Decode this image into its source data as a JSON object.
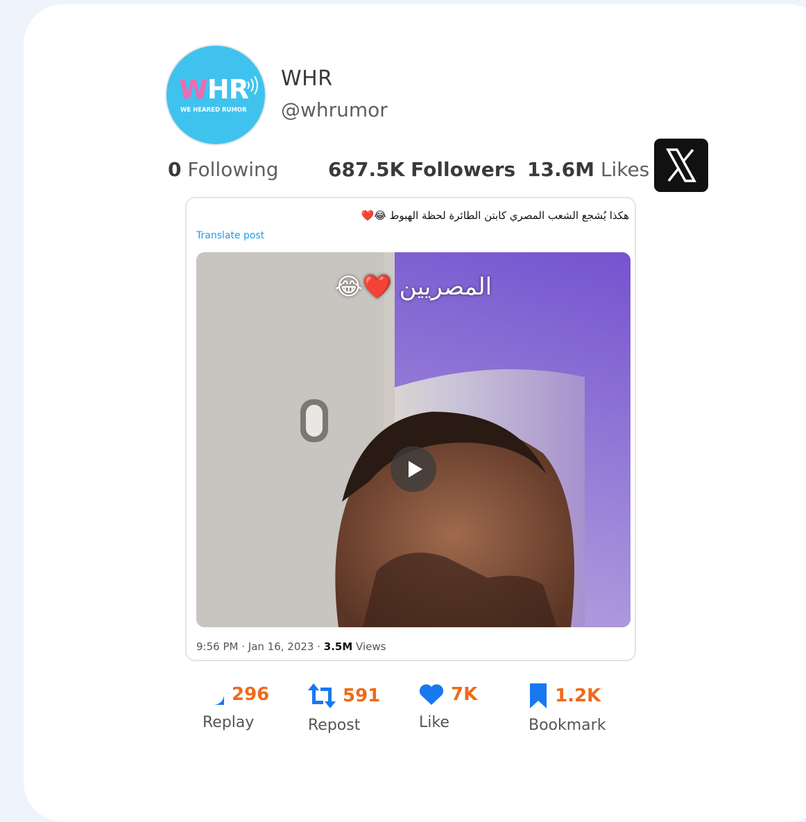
{
  "profile": {
    "name": "WHR",
    "handle": "@whrumor",
    "logo_w": "W",
    "logo_hr": "HR",
    "logo_tagline": "WE HEARED RUMOR"
  },
  "stats": {
    "following_count": "0",
    "following_label": "Following",
    "followers_count": "687.5K",
    "followers_label": "Followers",
    "likes_count": "13.6M",
    "likes_label": "Likes"
  },
  "tweet": {
    "text": "هكذا يُشجع الشعب المصري كابتن الطائرة لحظة الهبوط 😂❤️",
    "translate_label": "Translate post",
    "media_caption": "المصريين ❤️😂",
    "time": "9:56 PM",
    "date": "Jan 16, 2023",
    "views_count": "3.5M",
    "views_label": "Views"
  },
  "actions": [
    {
      "icon": "reply-icon",
      "count": "296",
      "label": "Replay"
    },
    {
      "icon": "repost-icon",
      "count": "591",
      "label": "Repost"
    },
    {
      "icon": "heart-icon",
      "count": "7K",
      "label": "Like"
    },
    {
      "icon": "bookmark-icon",
      "count": "1.2K",
      "label": "Bookmark"
    }
  ],
  "colors": {
    "background": "#eef3fc",
    "accent_count": "#ef6a1b",
    "icon_blue": "#1778f2",
    "link_blue": "#1d9bf0",
    "avatar_bg": "#3fc3ee"
  }
}
